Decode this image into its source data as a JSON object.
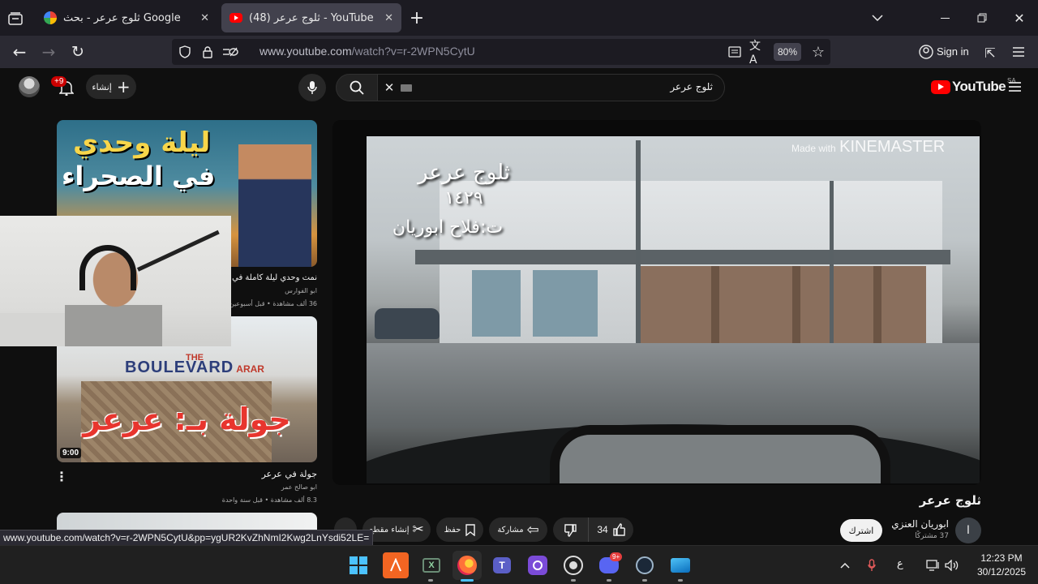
{
  "browser": {
    "tabs": [
      {
        "title": "ثلوج عرعر - بحث Google",
        "favicon": "google-icon"
      },
      {
        "title": "(48) ثلوج عرعر - YouTube",
        "favicon": "youtube-icon"
      }
    ],
    "url": "www.youtube.com/watch?v=r-2WPN5CytU",
    "url_host": "www.youtube.com",
    "url_path": "/watch?v=r-2WPN5CytU",
    "zoom": "80%",
    "sign_in": "Sign in",
    "status_url": "www.youtube.com/watch?v=r-2WPN5CytU&pp=ygUR2KvZhNmI2Kwg2LnYsdi52LE="
  },
  "youtube": {
    "logo_text": "YouTube",
    "region": "SA",
    "search_query": "ثلوج عرعر",
    "create_label": "إنشاء",
    "notif_badge": "+9",
    "video": {
      "title": "ثلوج عرعر",
      "overlay_title": "ثلوج عرعر",
      "overlay_year": "١٤٢٩",
      "overlay_credit": "ت:فلاح ابوريان",
      "watermark_prefix": "Made with",
      "watermark_brand": "KINEMASTER",
      "channel_name": "ابوريان العنزي",
      "channel_subs": "37 مشتركًا",
      "channel_initial": "ا",
      "subscribe": "اشترك",
      "likes": "34",
      "share": "مشاركة",
      "save": "حفظ",
      "clip": "إنشاء مقطع"
    },
    "recommendations": [
      {
        "thumb_text_1": "ليلة وحدي",
        "thumb_text_2": "في الصحراء",
        "title": "نمت وحدي ليلة كاملة في الصـ",
        "channel": "ابو الفوارس",
        "meta": "36 ألف مشاهدة • قبل أسبوعين"
      },
      {
        "thumb_text": "جولة بـ: عرعر",
        "sign_1": "THE",
        "sign_2": "BOULEVARD",
        "sign_3": "ARAR",
        "duration": "9:00",
        "title": "جولة في عرعر",
        "channel": "ابو صالح عمر",
        "meta": "8.3 ألف مشاهدة • قبل سنة واحدة"
      }
    ]
  },
  "taskbar": {
    "time": "12:23 PM",
    "date": "30/12/2025",
    "lang": "ع",
    "discord_badge": "9+"
  },
  "colors": {
    "youtube_red": "#ff0000",
    "tab_active": "#42414d",
    "toolbar": "#2b2a33",
    "taskbar": "#202020"
  }
}
